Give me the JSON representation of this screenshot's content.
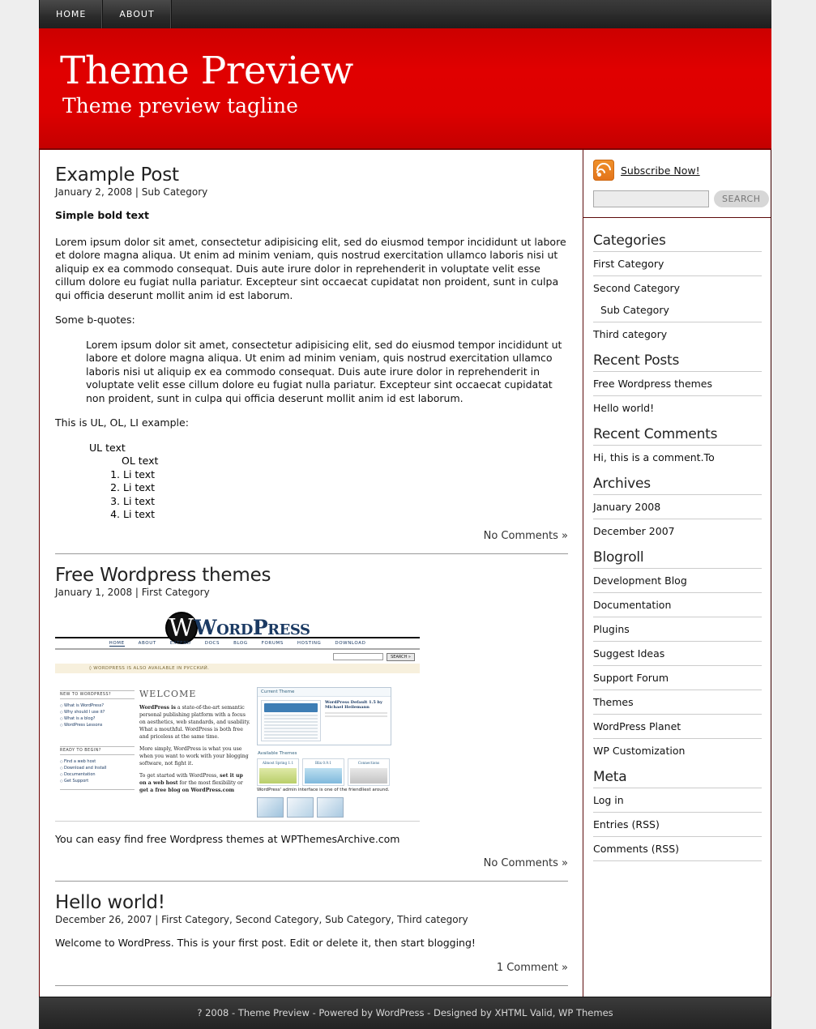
{
  "nav": {
    "items": [
      {
        "label": "HOME"
      },
      {
        "label": "ABOUT"
      }
    ]
  },
  "header": {
    "title": "Theme Preview",
    "tagline": "Theme preview tagline",
    "background_color": "#d40000"
  },
  "posts": [
    {
      "title": "Example Post",
      "meta": "January 2, 2008 | Sub Category",
      "bold_text": "Simple bold text",
      "paragraph1": "Lorem ipsum dolor sit amet, consectetur adipisicing elit, sed do eiusmod tempor incididunt ut labore et dolore magna aliqua. Ut enim ad minim veniam, quis nostrud exercitation ullamco laboris nisi ut aliquip ex ea commodo consequat. Duis aute irure dolor in reprehenderit in voluptate velit esse cillum dolore eu fugiat nulla pariatur. Excepteur sint occaecat cupidatat non proident, sunt in culpa qui officia deserunt mollit anim id est laborum.",
      "bquote_intro": "Some b-quotes:",
      "blockquote": "Lorem ipsum dolor sit amet, consectetur adipisicing elit, sed do eiusmod tempor incididunt ut labore et dolore magna aliqua. Ut enim ad minim veniam, quis nostrud exercitation ullamco laboris nisi ut aliquip ex ea commodo consequat. Duis aute irure dolor in reprehenderit in voluptate velit esse cillum dolore eu fugiat nulla pariatur. Excepteur sint occaecat cupidatat non proident, sunt in culpa qui officia deserunt mollit anim id est laborum.",
      "list_intro": "This is UL, OL, LI example:",
      "ul_text": "UL text",
      "ol_text": "OL text",
      "li_items": [
        "Li text",
        "Li text",
        "Li text",
        "Li text"
      ],
      "comments": "No Comments »"
    },
    {
      "title": "Free Wordpress themes",
      "meta": "January 1, 2008 | First Category",
      "body_text": "You can easy find free Wordpress themes at WPThemesArchive.com",
      "comments": "No Comments »"
    },
    {
      "title": "Hello world!",
      "meta": "December 26, 2007 | First Category, Second Category, Sub Category, Third category",
      "body_text": "Welcome to WordPress. This is your first post. Edit or delete it, then start blogging!",
      "comments": "1 Comment »"
    }
  ],
  "wp_screenshot": {
    "logo_text": "WordPress",
    "nav": [
      "HOME",
      "ABOUT",
      "EXTEND",
      "DOCS",
      "BLOG",
      "FORUMS",
      "HOSTING",
      "DOWNLOAD"
    ],
    "search_button": "SEARCH »",
    "notice": "◊ WORDPRESS IS ALSO AVAILABLE IN РУССКИЙ.",
    "welcome_heading": "WELCOME",
    "welcome_p1_bold": "WordPress is",
    "welcome_p1": " a state-of-the-art semantic personal publishing platform with a focus on aesthetics, web standards, and usability. What a mouthful. WordPress is both free and priceless at the same time.",
    "welcome_p2": "More simply, WordPress is what you use when you want to work with your blogging software, not fight it.",
    "welcome_p3_pre": "To get started with WordPress, ",
    "welcome_p3_b1": "set it up on a web host",
    "welcome_p3_mid": " for the most flexibility or ",
    "welcome_p3_b2": "get a free blog on WordPress.com",
    "welcome_p3_end": ".",
    "left_sections": [
      {
        "heading": "NEW TO WORDPRESS?",
        "links": [
          "What is WordPress?",
          "Why should I use it?",
          "What is a blog?",
          "WordPress Lessons"
        ]
      },
      {
        "heading": "READY TO BEGIN?",
        "links": [
          "Find a web host",
          "Download and Install",
          "Documentation",
          "Get Support"
        ]
      }
    ],
    "current_theme_label": "Current Theme",
    "current_theme_name": "WordPress Default 1.5 by Michael Heilemann",
    "available_themes_label": "Available Themes",
    "theme_cards": [
      "Almost Spring 1.1",
      "Blix 0.9.1",
      "Connections"
    ],
    "caption": "WordPress' admin interface is one of the friendliest around."
  },
  "sidebar": {
    "subscribe_label": "Subscribe Now!",
    "search_placeholder": "",
    "search_value": "",
    "search_button": "SEARCH",
    "widgets": [
      {
        "title": "Categories",
        "items": [
          {
            "label": "First Category",
            "sub": false
          },
          {
            "label": "Second Category",
            "sub": false
          },
          {
            "label": "Sub Category",
            "sub": true
          },
          {
            "label": "Third category",
            "sub": false
          }
        ]
      },
      {
        "title": "Recent Posts",
        "items": [
          {
            "label": "Free Wordpress themes",
            "sub": false
          },
          {
            "label": "Hello world!",
            "sub": false
          }
        ]
      },
      {
        "title": "Recent Comments",
        "items": [
          {
            "label": "Hi, this is a comment.To",
            "sub": false
          }
        ]
      },
      {
        "title": "Archives",
        "items": [
          {
            "label": "January 2008",
            "sub": false
          },
          {
            "label": "December 2007",
            "sub": false
          }
        ]
      },
      {
        "title": "Blogroll",
        "items": [
          {
            "label": "Development Blog",
            "sub": false
          },
          {
            "label": "Documentation",
            "sub": false
          },
          {
            "label": "Plugins",
            "sub": false
          },
          {
            "label": "Suggest Ideas",
            "sub": false
          },
          {
            "label": "Support Forum",
            "sub": false
          },
          {
            "label": "Themes",
            "sub": false
          },
          {
            "label": "WordPress Planet",
            "sub": false
          },
          {
            "label": "WP Customization",
            "sub": false
          }
        ]
      },
      {
        "title": "Meta",
        "items": [
          {
            "label": "Log in",
            "sub": false
          },
          {
            "label": "Entries (RSS)",
            "sub": false
          },
          {
            "label": "Comments (RSS)",
            "sub": false
          }
        ]
      }
    ]
  },
  "footer": {
    "text": "? 2008 - Theme Preview - Powered by WordPress - Designed by XHTML Valid, WP Themes"
  }
}
